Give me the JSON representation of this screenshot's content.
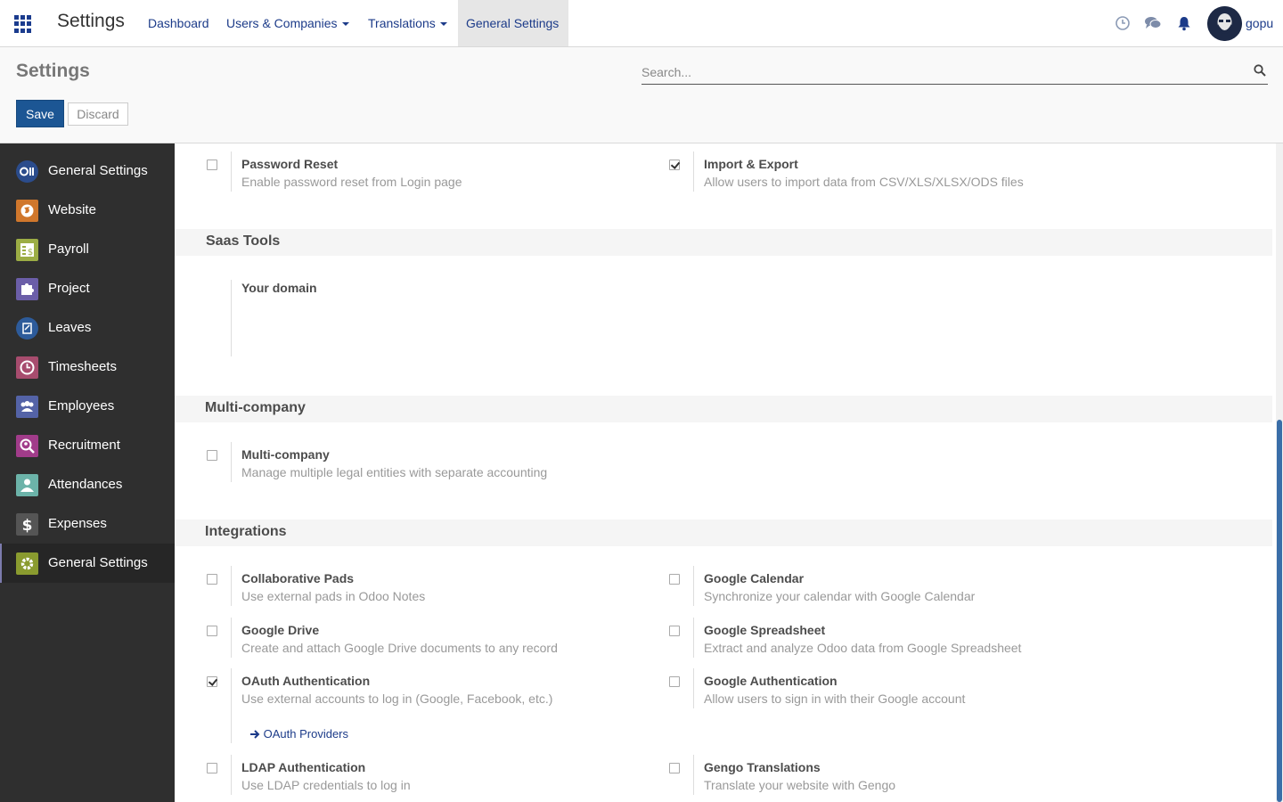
{
  "app": {
    "name": "Settings"
  },
  "menu": {
    "dashboard": "Dashboard",
    "users_companies": "Users & Companies",
    "translations": "Translations",
    "general_settings": "General Settings"
  },
  "user": {
    "name": "gopu"
  },
  "control": {
    "title": "Settings",
    "search_placeholder": "Search...",
    "save": "Save",
    "discard": "Discard"
  },
  "sidebar": {
    "items": [
      {
        "label": "General Settings",
        "icon": "odoo-logo-icon",
        "color": "#2b4c8c"
      },
      {
        "label": "Website",
        "icon": "globe-icon",
        "color": "#d0772c"
      },
      {
        "label": "Payroll",
        "icon": "payslip-icon",
        "color": "#9cad45"
      },
      {
        "label": "Project",
        "icon": "puzzle-icon",
        "color": "#6b5ea8"
      },
      {
        "label": "Leaves",
        "icon": "leaves-icon",
        "color": "#2d5b9a"
      },
      {
        "label": "Timesheets",
        "icon": "clock-icon",
        "color": "#a74c6e"
      },
      {
        "label": "Employees",
        "icon": "people-icon",
        "color": "#5463a7"
      },
      {
        "label": "Recruitment",
        "icon": "magnifier-person-icon",
        "color": "#a13c8a"
      },
      {
        "label": "Attendances",
        "icon": "attendance-icon",
        "color": "#6cb3a9"
      },
      {
        "label": "Expenses",
        "icon": "dollar-icon",
        "color": "#555555"
      },
      {
        "label": "General Settings",
        "icon": "gear-icon",
        "color": "#8a9b2f"
      }
    ]
  },
  "content": {
    "top_settings": [
      {
        "title": "Password Reset",
        "desc": "Enable password reset from Login page",
        "checked": false
      },
      {
        "title": "Import & Export",
        "desc": "Allow users to import data from CSV/XLS/XLSX/ODS files",
        "checked": true
      }
    ],
    "saas": {
      "heading": "Saas Tools",
      "domain_label": "Your domain"
    },
    "multi": {
      "heading": "Multi-company",
      "setting": {
        "title": "Multi-company",
        "desc": "Manage multiple legal entities with separate accounting",
        "checked": false
      }
    },
    "integrations": {
      "heading": "Integrations",
      "collab": {
        "title": "Collaborative Pads",
        "desc": "Use external pads in Odoo Notes",
        "checked": false
      },
      "gcal": {
        "title": "Google Calendar",
        "desc": "Synchronize your calendar with Google Calendar",
        "checked": false
      },
      "gdrive": {
        "title": "Google Drive",
        "desc": "Create and attach Google Drive documents to any record",
        "checked": false
      },
      "gsheet": {
        "title": "Google Spreadsheet",
        "desc": "Extract and analyze Odoo data from Google Spreadsheet",
        "checked": false
      },
      "oauth": {
        "title": "OAuth Authentication",
        "desc": "Use external accounts to log in (Google, Facebook, etc.)",
        "checked": true
      },
      "gauth": {
        "title": "Google Authentication",
        "desc": "Allow users to sign in with their Google account",
        "checked": false
      },
      "oauth_link": "OAuth Providers",
      "ldap": {
        "title": "LDAP Authentication",
        "desc": "Use LDAP credentials to log in",
        "checked": false
      },
      "gengo": {
        "title": "Gengo Translations",
        "desc": "Translate your website with Gengo",
        "checked": false
      }
    }
  }
}
